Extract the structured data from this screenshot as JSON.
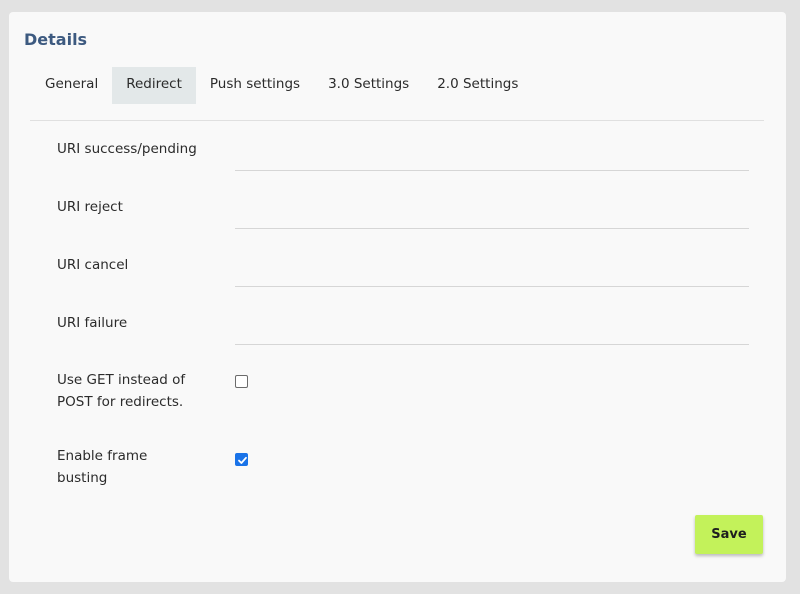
{
  "card": {
    "title": "Details"
  },
  "tabs": [
    {
      "label": "General",
      "active": false
    },
    {
      "label": "Redirect",
      "active": true
    },
    {
      "label": "Push settings",
      "active": false
    },
    {
      "label": "3.0 Settings",
      "active": false
    },
    {
      "label": "2.0 Settings",
      "active": false
    }
  ],
  "fields": {
    "uri_success": {
      "label": "URI success/pending",
      "value": ""
    },
    "uri_reject": {
      "label": "URI reject",
      "value": ""
    },
    "uri_cancel": {
      "label": "URI cancel",
      "value": ""
    },
    "uri_failure": {
      "label": "URI failure",
      "value": ""
    }
  },
  "checkboxes": {
    "use_get": {
      "label_line1": "Use GET instead of",
      "label_line2": "POST for redirects.",
      "checked": false
    },
    "frame_busting": {
      "label_line1": "Enable frame",
      "label_line2": "busting",
      "checked": true
    }
  },
  "actions": {
    "save_label": "Save"
  },
  "colors": {
    "title": "#3d5a80",
    "active_tab": "#e3e8e9",
    "save_button": "#c3f25a",
    "checkbox_checked": "#1a73e8"
  }
}
